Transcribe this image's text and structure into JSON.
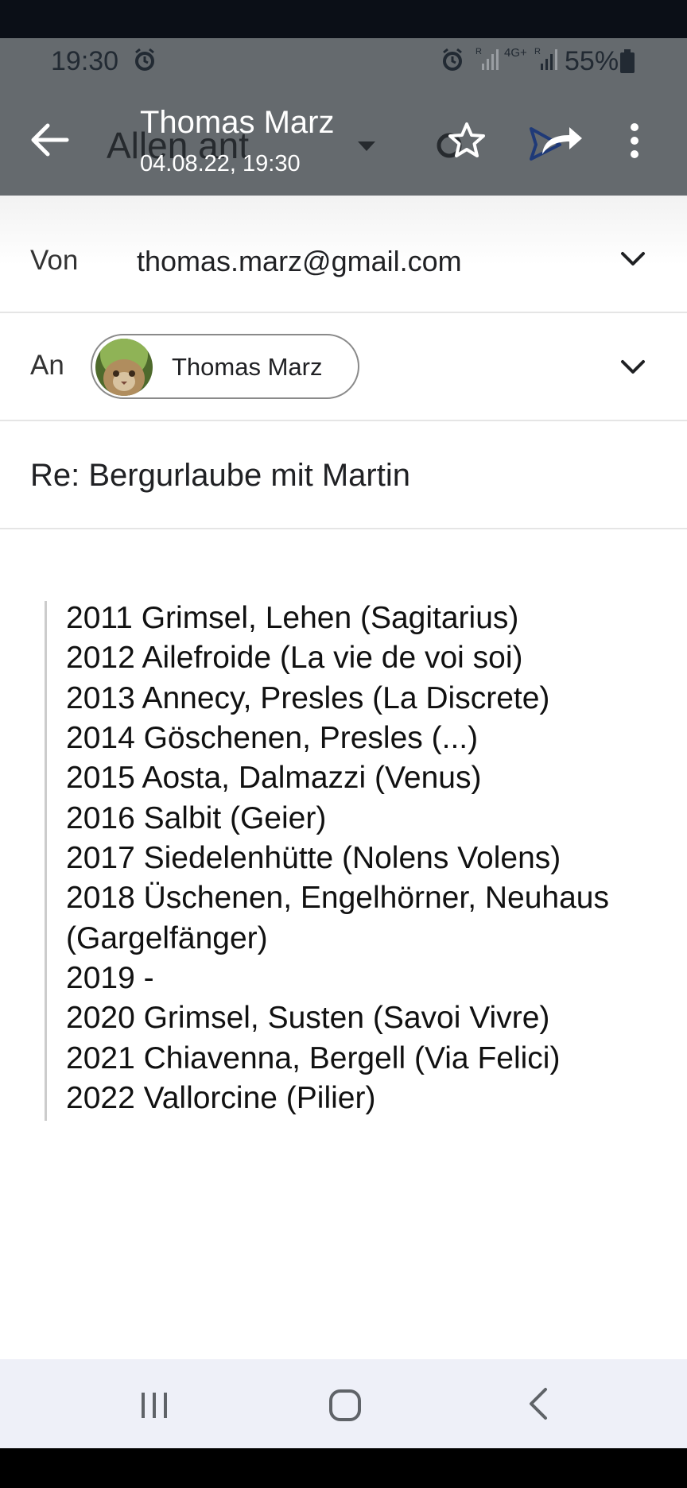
{
  "status_bar": {
    "time": "19:30",
    "network": "4G+",
    "roaming": "R",
    "battery": "55%"
  },
  "app_bar": {
    "sender_name": "Thomas Marz",
    "date": "04.08.22, 19:30",
    "ghost_reply_label": "Allen ant",
    "icons": [
      "back-arrow-icon",
      "star-icon",
      "forward-icon",
      "more-vert-icon"
    ]
  },
  "from": {
    "label": "Von",
    "value": "thomas.marz@gmail.com"
  },
  "to": {
    "label": "An",
    "recipient": "Thomas Marz"
  },
  "subject": "Re: Bergurlaube mit Martin",
  "quote_lines": [
    "2011 Grimsel, Lehen (Sagitarius)",
    "2012 Ailefroide (La vie de voi soi)",
    "2013 Annecy, Presles (La Discrete)",
    "2014 Göschenen, Presles (...)",
    "2015 Aosta, Dalmazzi (Venus)",
    "2016 Salbit (Geier)",
    "2017 Siedelenhütte (Nolens Volens)",
    "2018 Üschenen, Engelhörner, Neuhaus",
    "(Gargelfänger)",
    "2019 -",
    "2020 Grimsel, Susten (Savoi Vivre)",
    "2021 Chiavenna, Bergell (Via Felici)",
    "2022 Vallorcine (Pilier)"
  ],
  "colors": {
    "app_bar": "#656a6e",
    "nav_bar": "#eef0f8",
    "forward_accent": "#1f3a78"
  }
}
